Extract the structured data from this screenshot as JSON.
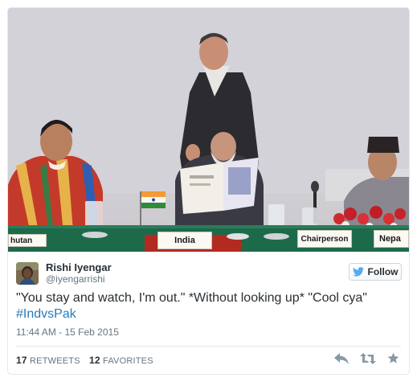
{
  "photo": {
    "placards": {
      "bhutan": "hutan",
      "india": "India",
      "chair": "Chairperson",
      "nepal": "Nepa"
    }
  },
  "tweet": {
    "author": {
      "display_name": "Rishi Iyengar",
      "handle": "@iyengarrishi"
    },
    "follow_label": "Follow",
    "text_main": "\"You stay and watch, I'm out.\" *Without looking up* \"Cool cya\"",
    "hashtag": "#IndvsPak",
    "timestamp": "11:44 AM - 15 Feb 2015",
    "stats": {
      "retweets_count": "17",
      "retweets_label": "RETWEETS",
      "favorites_count": "12",
      "favorites_label": "FAVORITES"
    },
    "actions": {
      "reply_icon": "reply-icon",
      "retweet_icon": "retweet-icon",
      "favorite_icon": "star-icon"
    }
  },
  "colors": {
    "link": "#2b7bb9",
    "twitter_blue": "#55acee",
    "muted_text": "#66757f",
    "action_icon": "#8899a6",
    "border": "#e1e8ed"
  }
}
